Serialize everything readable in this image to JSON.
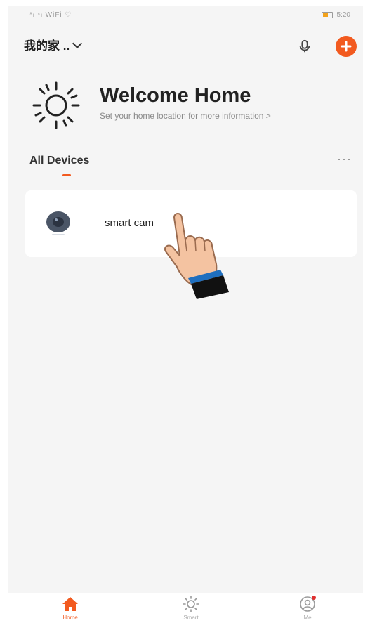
{
  "status_bar": {
    "left": "*ₗ *ₗ WiFi ♡",
    "battery_label": "▣",
    "time": "5:20"
  },
  "header": {
    "home_name": "我的家 ..",
    "icons": [
      "microphone-icon",
      "plus-icon"
    ],
    "accent_color": "#f25a1f"
  },
  "welcome": {
    "title": "Welcome Home",
    "subtitle": "Set your home location for more information >"
  },
  "devices": {
    "section_title": "All Devices",
    "more_label": "···",
    "items": [
      {
        "name": "smart cam",
        "icon": "camera-icon"
      }
    ]
  },
  "tabbar": {
    "tabs": [
      {
        "label": "Home",
        "icon": "house-icon",
        "active": true
      },
      {
        "label": "Smart",
        "icon": "sun-icon",
        "active": false
      },
      {
        "label": "Me",
        "icon": "user-icon",
        "active": false
      }
    ]
  }
}
